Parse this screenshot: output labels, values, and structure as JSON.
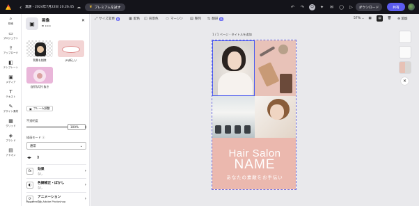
{
  "topbar": {
    "back_label": "‹",
    "title": "無題 - 2024年7月22日 20.26.45",
    "premium_label": "プレミアムを試す",
    "download_label": "ダウンロード",
    "share_label": "共有"
  },
  "rail": [
    {
      "glyph": "⌕",
      "label": "検索"
    },
    {
      "glyph": "▭",
      "label": "プロジェクト"
    },
    {
      "glyph": "⇪",
      "label": "アップロード"
    },
    {
      "glyph": "◧",
      "label": "テンプレート"
    },
    {
      "glyph": "▣",
      "label": "メディア"
    },
    {
      "glyph": "T",
      "label": "テキスト"
    },
    {
      "glyph": "✎",
      "label": "デザイン素材"
    },
    {
      "glyph": "▦",
      "label": "グリッド"
    },
    {
      "glyph": "◈",
      "label": "ブランド"
    },
    {
      "glyph": "▤",
      "label": "アドオン"
    }
  ],
  "panel": {
    "title": "画像",
    "thumbs": [
      {
        "label": "背景を削除"
      },
      {
        "label": "(R)新しい"
      },
      {
        "label": "自然な切り抜き"
      }
    ],
    "frame_button": "フレーム調整",
    "opacity_label": "不透明度",
    "opacity_value": "100%",
    "blend_label": "描画モード",
    "blend_value": "通常",
    "rows": [
      {
        "icon": "fx",
        "title": "効果",
        "sub": "なし"
      },
      {
        "icon": "◐",
        "title": "色調補正・ぼかし",
        "sub": "なし"
      },
      {
        "icon": "⟳",
        "title": "アニメーション",
        "sub": "なし"
      }
    ],
    "footer": "Powered by Adobe Photoshop"
  },
  "canvas_toolbar": {
    "items": [
      {
        "glyph": "⤢",
        "label": "サイズ変更",
        "tag": "新"
      },
      {
        "glyph": "▦",
        "label": "配色"
      },
      {
        "glyph": "◫",
        "label": "背景色"
      },
      {
        "glyph": "▭",
        "label": "マージン"
      },
      {
        "glyph": "▤",
        "label": "整列"
      },
      {
        "glyph": "⇆",
        "label": "翻訳",
        "tag": "新"
      }
    ],
    "zoom": "57%",
    "add_label": "追加"
  },
  "page_label": "1 / 1 ページ - タイトルを追加",
  "design": {
    "title_line1": "Hair Salon",
    "title_line2": "NAME",
    "subtitle": "あなたの素敵をお手伝い"
  }
}
